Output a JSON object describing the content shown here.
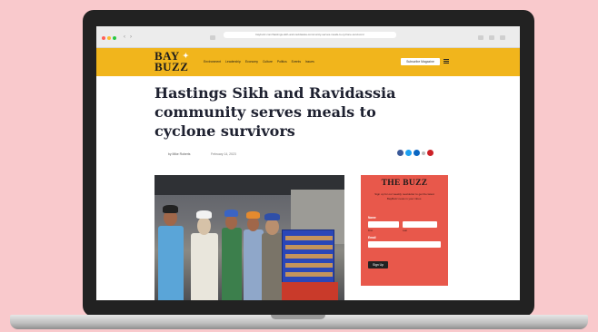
{
  "browser": {
    "url": "baybuzz.com/hastings-sikh-and-ravidassia-community-serves-meals-to-cyclone-survivors/",
    "back_icon": "back-arrow-icon",
    "forward_icon": "forward-arrow-icon"
  },
  "site": {
    "logo_line1": "BAY",
    "logo_line2": "BUZZ",
    "nav": [
      "Environment",
      "Leadership",
      "Economy",
      "Culture",
      "Politics",
      "Events",
      "Issues"
    ],
    "subscribe_label": "Subscribe Magazine"
  },
  "article": {
    "title": "Hastings Sikh and Ravidassia community serves meals to cyclone survivors",
    "author": "by Mike Roberts",
    "date": "February 14, 2023"
  },
  "share": {
    "colors": [
      "#3b5998",
      "#1da1f2",
      "#0a66c2",
      "#cc2127"
    ]
  },
  "widget": {
    "title": "THE BUZZ",
    "text": "Sign up for our weekly newsletter to get the latest BayBuzz news in your inbox.",
    "name_label": "Name",
    "first_hint": "First",
    "last_hint": "Last",
    "email_label": "Email",
    "button_label": "Sign Up"
  },
  "colors": {
    "header": "#f1b51c",
    "widget": "#e8584b",
    "background": "#f9c9cc"
  }
}
